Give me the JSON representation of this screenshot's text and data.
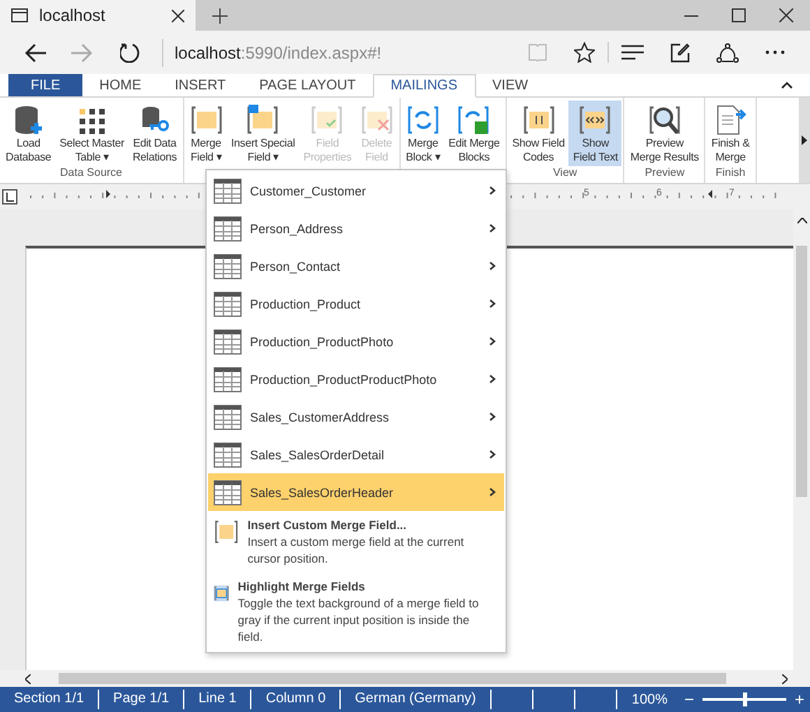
{
  "browser": {
    "tab_title": "localhost",
    "address_host": "localhost",
    "address_path": ":5990/index.aspx#!",
    "forward_disabled": true
  },
  "ribbon": {
    "tabs": [
      {
        "label": "FILE",
        "kind": "file",
        "selected": false
      },
      {
        "label": "HOME",
        "kind": "tab",
        "selected": false
      },
      {
        "label": "INSERT",
        "kind": "tab",
        "selected": false
      },
      {
        "label": "PAGE LAYOUT",
        "kind": "tab",
        "selected": false
      },
      {
        "label": "MAILINGS",
        "kind": "tab",
        "selected": true
      },
      {
        "label": "VIEW",
        "kind": "tab",
        "selected": false
      }
    ],
    "groups": [
      {
        "label": "Data Source",
        "buttons": [
          {
            "lines": [
              "Load",
              "Database"
            ],
            "disabled": false,
            "selected": false
          },
          {
            "lines": [
              "Select Master",
              "Table ▾"
            ],
            "disabled": false,
            "selected": false
          },
          {
            "lines": [
              "Edit Data",
              "Relations"
            ],
            "disabled": false,
            "selected": false
          }
        ]
      },
      {
        "buttons": [
          {
            "lines": [
              "Merge",
              "Field ▾"
            ],
            "disabled": false,
            "selected": false
          },
          {
            "lines": [
              "Insert Special",
              "Field ▾"
            ],
            "disabled": false,
            "selected": false
          },
          {
            "lines": [
              "Field",
              "Properties"
            ],
            "disabled": true,
            "selected": false
          },
          {
            "lines": [
              "Delete",
              "Field"
            ],
            "disabled": true,
            "selected": false
          }
        ]
      },
      {
        "buttons": [
          {
            "lines": [
              "Merge",
              "Block ▾"
            ],
            "disabled": false,
            "selected": false
          },
          {
            "lines": [
              "Edit Merge",
              "Blocks"
            ],
            "disabled": false,
            "selected": false
          }
        ]
      },
      {
        "label": "View",
        "buttons": [
          {
            "lines": [
              "Show Field",
              "Codes"
            ],
            "disabled": false,
            "selected": false
          },
          {
            "lines": [
              "Show",
              "Field Text"
            ],
            "disabled": false,
            "selected": true
          }
        ]
      },
      {
        "label": "Preview",
        "buttons": [
          {
            "lines": [
              "Preview",
              "Merge Results"
            ],
            "disabled": false,
            "selected": false
          }
        ]
      },
      {
        "label": "Finish",
        "buttons": [
          {
            "lines": [
              "Finish &",
              "Merge"
            ],
            "disabled": false,
            "selected": false
          }
        ]
      }
    ]
  },
  "ruler": {
    "numbers": [
      "5",
      "6",
      "7"
    ]
  },
  "menu": {
    "items": [
      {
        "label": "Customer_Customer",
        "selected": false
      },
      {
        "label": "Person_Address",
        "selected": false
      },
      {
        "label": "Person_Contact",
        "selected": false
      },
      {
        "label": "Production_Product",
        "selected": false
      },
      {
        "label": "Production_ProductPhoto",
        "selected": false
      },
      {
        "label": "Production_ProductProductPhoto",
        "selected": false
      },
      {
        "label": "Sales_CustomerAddress",
        "selected": false
      },
      {
        "label": "Sales_SalesOrderDetail",
        "selected": false
      },
      {
        "label": "Sales_SalesOrderHeader",
        "selected": true
      }
    ],
    "commands": [
      {
        "kind": "custom",
        "title": "Insert Custom Merge Field...",
        "description": "Insert a custom merge field at the current cursor position."
      },
      {
        "kind": "highlight",
        "title": "Highlight Merge Fields",
        "description": "Toggle the text background of a merge field to gray if the current input position is inside the field."
      }
    ]
  },
  "status_bar": {
    "cells": [
      "Section 1/1",
      "Page 1/1",
      "Line 1",
      "Column 0",
      "German (Germany)"
    ],
    "zoom": "100%",
    "minus": "−",
    "plus": "+",
    "level": 0.5
  }
}
